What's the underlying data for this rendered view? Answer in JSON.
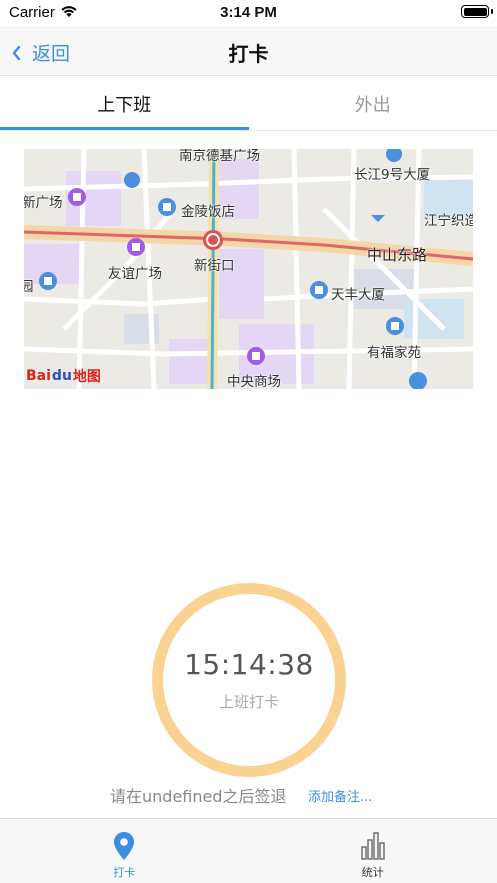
{
  "status_bar": {
    "carrier": "Carrier",
    "time": "3:14 PM"
  },
  "nav": {
    "back_label": "返回",
    "title": "打卡"
  },
  "tabs": [
    {
      "label": "上下班",
      "active": true
    },
    {
      "label": "外出",
      "active": false
    }
  ],
  "map": {
    "labels": {
      "nanjing_deji": "南京德基广场",
      "changjiang9": "长江9号大厦",
      "xin_guangchang": "新广场",
      "jinling_hotel": "金陵饭店",
      "jiangning": "江宁织造",
      "zhongshan_east_road": "中山东路",
      "youyi_plaza": "友谊广场",
      "xinjiekou": "新街口",
      "tianfeng": "天丰大厦",
      "youfu": "有福家苑",
      "zhongyang_mall": "中央商场",
      "yuan": "园"
    },
    "logo_bai": "Bai",
    "logo_du": "du",
    "logo_map": "地图"
  },
  "clock": {
    "time": "15:14:38",
    "label": "上班打卡"
  },
  "hint": "请在undefined之后签退",
  "add_note": "添加备注...",
  "bottom_tabs": [
    {
      "label": "打卡",
      "icon": "location-pin-icon",
      "active": true
    },
    {
      "label": "统计",
      "icon": "bar-chart-icon",
      "active": false
    }
  ],
  "colors": {
    "accent": "#3c8ee0",
    "ring": "#f9d391",
    "road_main": "#e06666",
    "metro": "#4bb0e0"
  }
}
